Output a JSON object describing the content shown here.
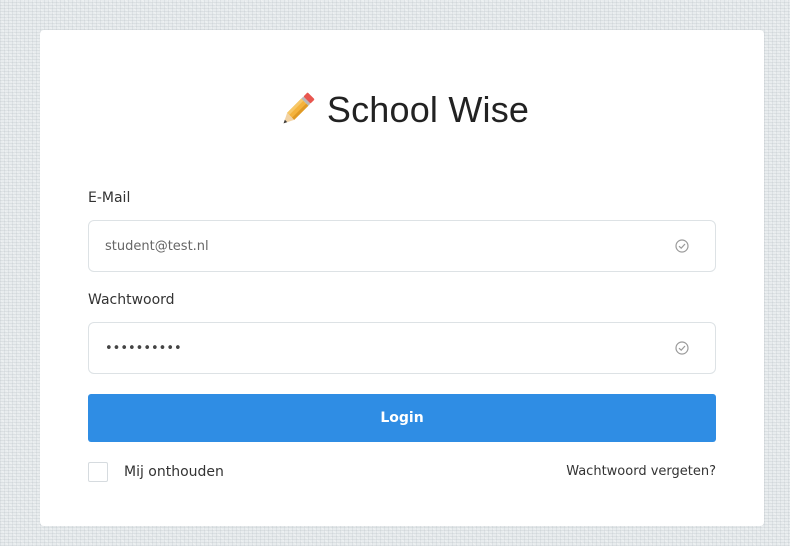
{
  "brand": {
    "title": "School Wise",
    "logo_icon": "pencil-icon"
  },
  "form": {
    "email": {
      "label": "E-Mail",
      "value": "student@test.nl",
      "status_icon": "check-circle-icon"
    },
    "password": {
      "label": "Wachtwoord",
      "value": "••••••••••",
      "status_icon": "check-circle-icon"
    },
    "login_label": "Login",
    "remember_label": "Mij onthouden",
    "forgot_label": "Wachtwoord vergeten?"
  },
  "colors": {
    "primary_button": "#2f8de4",
    "background": "#e8ecee",
    "card": "#ffffff"
  }
}
